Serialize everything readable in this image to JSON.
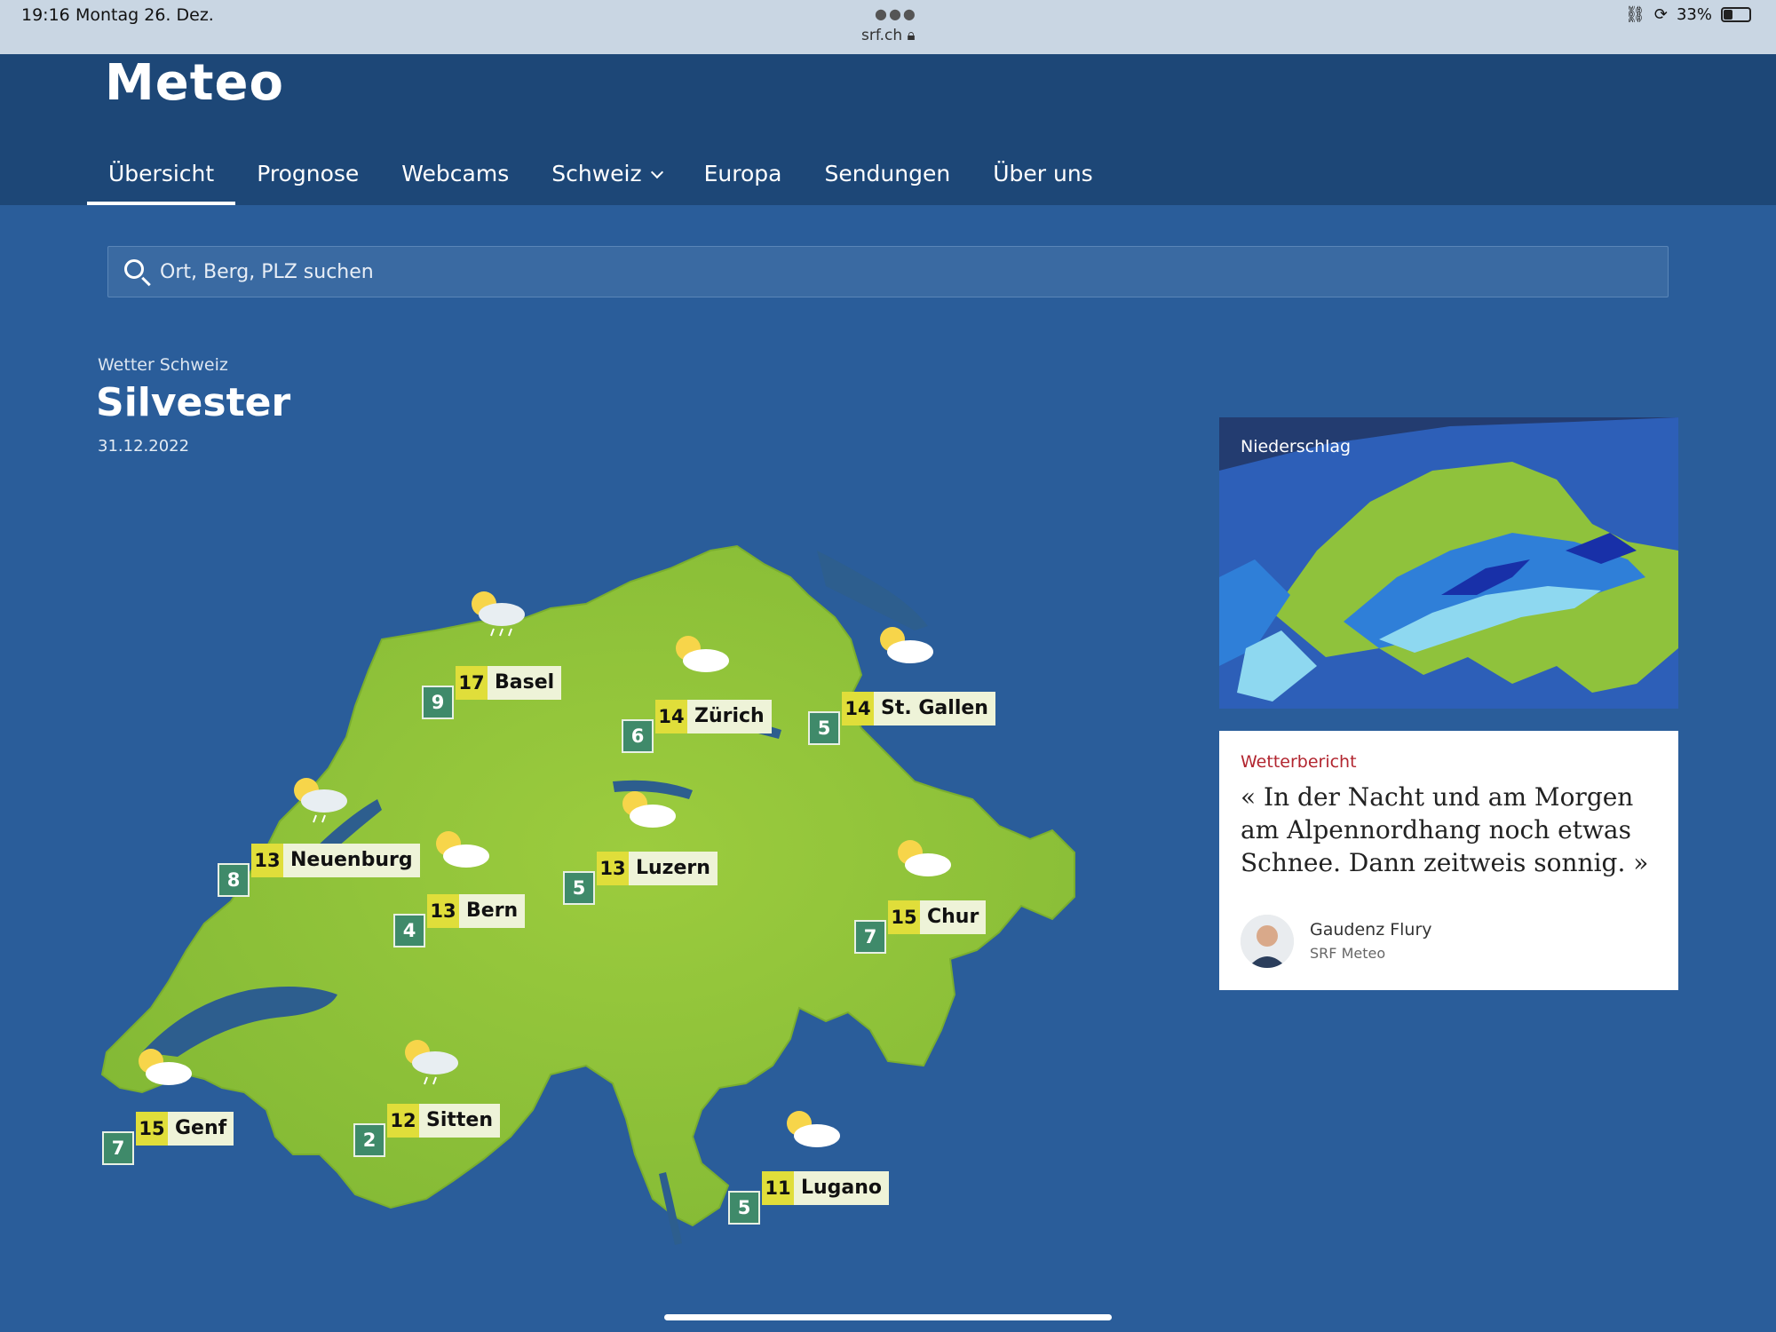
{
  "status_bar": {
    "time": "19:16",
    "date": "Montag 26. Dez.",
    "url": "srf.ch",
    "battery": "33%"
  },
  "header": {
    "logo": "Meteo",
    "nav": [
      {
        "label": "Übersicht",
        "active": true
      },
      {
        "label": "Prognose"
      },
      {
        "label": "Webcams"
      },
      {
        "label": "Schweiz"
      },
      {
        "label": "Europa"
      },
      {
        "label": "Sendungen"
      },
      {
        "label": "Über uns"
      }
    ]
  },
  "search": {
    "placeholder": "Ort, Berg, PLZ suchen"
  },
  "section": {
    "eyebrow": "Wetter Schweiz",
    "title": "Silvester",
    "date": "31.12.2022"
  },
  "cities": [
    {
      "name": "Basel",
      "max": "17",
      "min": "9",
      "icon": "sun-cloud-rain-icon"
    },
    {
      "name": "Zürich",
      "max": "14",
      "min": "6",
      "icon": "sun-cloud-icon"
    },
    {
      "name": "St. Gallen",
      "max": "14",
      "min": "5",
      "icon": "sun-cloud-icon"
    },
    {
      "name": "Neuenburg",
      "max": "13",
      "min": "8",
      "icon": "sun-cloud-rain-icon"
    },
    {
      "name": "Bern",
      "max": "13",
      "min": "4",
      "icon": "sun-cloud-icon"
    },
    {
      "name": "Luzern",
      "max": "13",
      "min": "5",
      "icon": "sun-cloud-icon"
    },
    {
      "name": "Chur",
      "max": "15",
      "min": "7",
      "icon": "sun-cloud-icon"
    },
    {
      "name": "Genf",
      "max": "15",
      "min": "7",
      "icon": "sun-cloud-icon"
    },
    {
      "name": "Sitten",
      "max": "12",
      "min": "2",
      "icon": "sun-cloud-rain-icon"
    },
    {
      "name": "Lugano",
      "max": "11",
      "min": "5",
      "icon": "sun-cloud-icon"
    }
  ],
  "precipitation": {
    "label": "Niederschlag"
  },
  "report": {
    "label": "Wetterbericht",
    "quote": "« In der Nacht und am Morgen am Alpennordhang noch etwas Schnee. Dann zeitweis sonnig. »",
    "author": "Gaudenz Flury",
    "org": "SRF Meteo"
  },
  "colors": {
    "header": "#1d4777",
    "background": "#2a5d9a",
    "land": "#8fc23c",
    "accent_red": "#b2252f"
  }
}
